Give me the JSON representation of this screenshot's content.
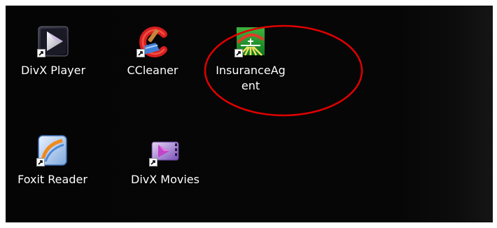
{
  "desktop": {
    "icons": [
      {
        "label": "DivX Player",
        "icon": "divx-player-icon",
        "shortcut": true
      },
      {
        "label": "CCleaner",
        "icon": "ccleaner-icon",
        "shortcut": true
      },
      {
        "label": "InsuranceAgent",
        "icon": "insurance-agent-icon",
        "shortcut": true
      },
      {
        "label": "Foxit Reader",
        "icon": "foxit-reader-icon",
        "shortcut": true
      },
      {
        "label": "DivX Movies",
        "icon": "divx-movies-icon",
        "shortcut": true
      }
    ],
    "annotation": {
      "shape": "ellipse",
      "color": "#e00000",
      "target": "InsuranceAgent"
    }
  },
  "colors": {
    "background": "#050505",
    "label_text": "#ffffff",
    "annotation": "#e00000"
  }
}
